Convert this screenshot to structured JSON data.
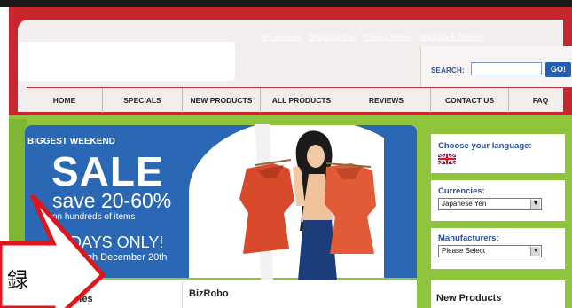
{
  "header": {
    "top_links": [
      "My Account",
      "Shopping Cart",
      "Privacy Notice",
      "Shipping & Returns"
    ],
    "search": {
      "label": "SEARCH:",
      "value": "",
      "button": "GO!"
    }
  },
  "nav": {
    "items": [
      "HOME",
      "SPECIALS",
      "NEW PRODUCTS",
      "ALL PRODUCTS",
      "REVIEWS",
      "CONTACT US",
      "FAQ"
    ]
  },
  "banner": {
    "line1": "BIGGEST WEEKEND",
    "line2": "SALE",
    "line3": "save 20-60%",
    "line4": "on hundreds of items",
    "line5": "DAYS ONLY!",
    "line6": "rough December 20th"
  },
  "sidebar": {
    "language_title": "Choose your language:",
    "currencies_title": "Currencies:",
    "currencies_value": "Japanese Yen",
    "manufacturers_title": "Manufacturers:",
    "manufacturers_value": "Please Select"
  },
  "bottom": {
    "left_title": "ries",
    "mid_title": "BizRobo",
    "right_title": "New Products"
  },
  "callout": {
    "text": "録"
  },
  "colors": {
    "header_red": "#c8262c",
    "green": "#8fc53d",
    "banner_blue": "#2a67b4",
    "link_blue": "#2b4f96"
  }
}
